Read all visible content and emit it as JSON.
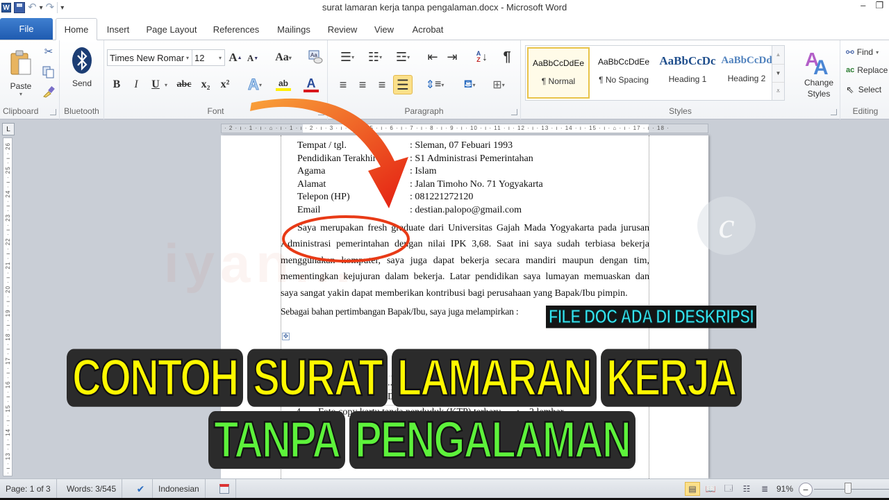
{
  "window": {
    "title": "surat lamaran kerja tanpa pengalaman.docx - Microsoft Word",
    "app_icon": "W",
    "quick_access": [
      "save-icon",
      "undo-icon",
      "redo-icon",
      "customize-dropdown-icon"
    ],
    "controls": {
      "minimize": "–",
      "restore": "❐"
    }
  },
  "tabs": {
    "file": "File",
    "items": [
      {
        "label": "Home",
        "active": true
      },
      {
        "label": "Insert"
      },
      {
        "label": "Page Layout"
      },
      {
        "label": "References"
      },
      {
        "label": "Mailings"
      },
      {
        "label": "Review"
      },
      {
        "label": "View"
      },
      {
        "label": "Acrobat"
      }
    ]
  },
  "ribbon": {
    "clipboard": {
      "label": "Clipboard",
      "paste": "Paste"
    },
    "bluetooth": {
      "label": "Bluetooth",
      "send": "Send"
    },
    "font": {
      "label": "Font",
      "font_name": "Times New Romar",
      "font_size": "12",
      "grow": "A",
      "shrink": "A",
      "change_case": "Aa",
      "bold": "B",
      "italic": "I",
      "underline": "U",
      "strikethrough": "abc",
      "subscript": "x₂",
      "superscript": "x²",
      "text_effects": "A",
      "highlight": "ab",
      "font_color": "A",
      "highlight_color": "#ffef00",
      "font_color_value": "#d9161c"
    },
    "paragraph": {
      "label": "Paragraph",
      "show_marks": "¶",
      "active_alignment": "justify"
    },
    "styles": {
      "label": "Styles",
      "items": [
        {
          "preview": "AaBbCcDdEe",
          "name": "¶ Normal",
          "selected": true
        },
        {
          "preview": "AaBbCcDdEe",
          "name": "¶ No Spacing"
        },
        {
          "preview": "AaBbCcDc",
          "name": "Heading 1"
        },
        {
          "preview": "AaBbCcDd",
          "name": "Heading 2"
        }
      ],
      "change_styles": "Change Styles"
    },
    "editing": {
      "label": "Editing",
      "find": "Find",
      "replace": "Replace",
      "select": "Select"
    }
  },
  "rulers": {
    "horizontal": "· 2 · ı · 1 · ı · ⌂ · ı · 1 · ı · 2 · ı · 3 · ı · 4 · ı · 5 · ı · 6 · ı · 7 · ı · 8 · ı · 9 · ı · 10 · ı · 11 · ı · 12 · ı · 13 · ı · 14 · ı · 15 · ı · ⌂ · ı · 17 · ı · 18 ·",
    "vertical": "ı · 12 · ı · 13 · ı · 14 · ı · 15 · ı · 16 · ı · 17 · ı · 18 · ı · 19 · ı · 20 · ı · 21 · ı · 22 · ı · 23 · ı · 24 · ı · 25 · ı · 26"
  },
  "document": {
    "info": [
      {
        "key": "Tempat / tgl.",
        "value": ": Sleman, 07 Febuari 1993"
      },
      {
        "key": "Pendidikan Terakhir",
        "value": ": S1 Administrasi Pemerintahan"
      },
      {
        "key": "Agama",
        "value": ": Islam"
      },
      {
        "key": "Alamat",
        "value": ": Jalan Timoho No. 71 Yogyakarta"
      },
      {
        "key": "Telepon (HP)",
        "value": ": 081221272120"
      },
      {
        "key": "Email",
        "value": ": destian.palopo@gmail.com"
      }
    ],
    "paragraph_lines": [
      "Saya merupakan fresh graduate dari Universitas Gajah Mada  Yogyakarta pada jurusan",
      "Administrasi pemerintahan dengan nilai IPK 3,68. Saat ini saya sudah terbiasa bekerja",
      "menggunakan komputer, saya juga dapat bekerja secara mandiri maupun dengan tim,",
      "mementingkan kejujuran dalam bekerja. Latar pendidikan saya lumayan memuaskan dan",
      "saya sangat yakin dapat memberikan kontribusi bagi perusahaan yang Bapak/Ibu pimpin."
    ],
    "lampiran": "Sebagai bahan pertimbangan Bapak/Ibu, saya juga melampirkan :",
    "table_rows": [
      {
        "no": "",
        "item": "...an",
        "sep": "",
        "qty": ""
      },
      {
        "no": "",
        "item": "D...",
        "sep": "",
        "qty": ""
      },
      {
        "no": "4",
        "item": "Foto copy kartu tanda penduduk (KTP) terbaru",
        "sep": ":",
        "qty": "2 lembar"
      }
    ]
  },
  "overlay": {
    "note": "FILE DOC ADA DI DESKRIPSI",
    "headline_words": [
      "CONTOH",
      "SURAT",
      "LAMARAN",
      "KERJA"
    ],
    "subheadline_words": [
      "TANPA",
      "PENGALAMAN"
    ],
    "watermark": "iyan...",
    "watermark_badge": "c",
    "colors": {
      "headline": "#fff900",
      "subheadline": "#5df23b",
      "note": "#36e6f2",
      "arrow": "#f0481c"
    }
  },
  "statusbar": {
    "page": "Page: 1 of 3",
    "words": "Words: 3/545",
    "language": "Indonesian",
    "zoom": "91%",
    "zoom_value_percent": 91
  }
}
